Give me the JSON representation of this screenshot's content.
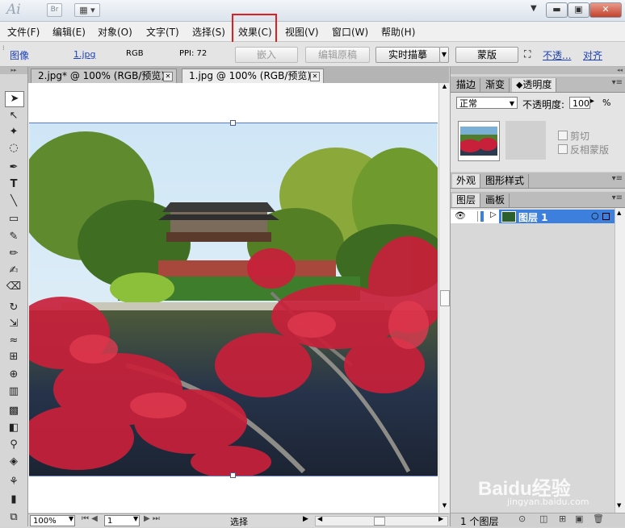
{
  "titlebar": {
    "app_logo": "Ai",
    "bridge_label": "Br",
    "minimize": "▬",
    "restore": "▣",
    "close": "✕"
  },
  "menus": [
    "文件(F)",
    "编辑(E)",
    "对象(O)",
    "文字(T)",
    "选择(S)",
    "效果(C)",
    "视图(V)",
    "窗口(W)",
    "帮助(H)"
  ],
  "controlbar": {
    "type_label": "图像",
    "filename": "1.jpg",
    "colormode": "RGB",
    "ppi": "PPI: 72",
    "embed_btn": "嵌入",
    "edit_original_btn": "编辑原稿",
    "live_trace_btn": "实时描摹",
    "mask_btn": "蒙版",
    "opacity_link": "不透...",
    "align_link": "对齐"
  },
  "tabs": [
    {
      "label": "2.jpg* @ 100% (RGB/预览)",
      "active": false
    },
    {
      "label": "1.jpg @ 100% (RGB/预览)",
      "active": true
    }
  ],
  "statusbar": {
    "zoom": "100%",
    "artboard": "1",
    "status_label": "选择"
  },
  "transparency_panel": {
    "tabs": [
      "描边",
      "渐变",
      "透明度"
    ],
    "blend_mode": "正常",
    "opacity_label": "不透明度:",
    "opacity_value": "100",
    "opacity_unit": "%",
    "clip_label": "剪切",
    "invert_mask_label": "反相蒙版"
  },
  "appearance_panel": {
    "tabs": [
      "外观",
      "图形样式"
    ]
  },
  "layers_panel": {
    "tabs": [
      "图层",
      "画板"
    ],
    "layers": [
      {
        "name": "图层 1",
        "selected": true
      }
    ],
    "count": "1 个图层"
  },
  "watermark": {
    "brand": "Baidu经验",
    "url": "jingyan.baidu.com"
  },
  "colors": {
    "accent_blue": "#3d7fdc",
    "layer_selected": "#3d7fdc",
    "highlight_red": "#e02020"
  }
}
